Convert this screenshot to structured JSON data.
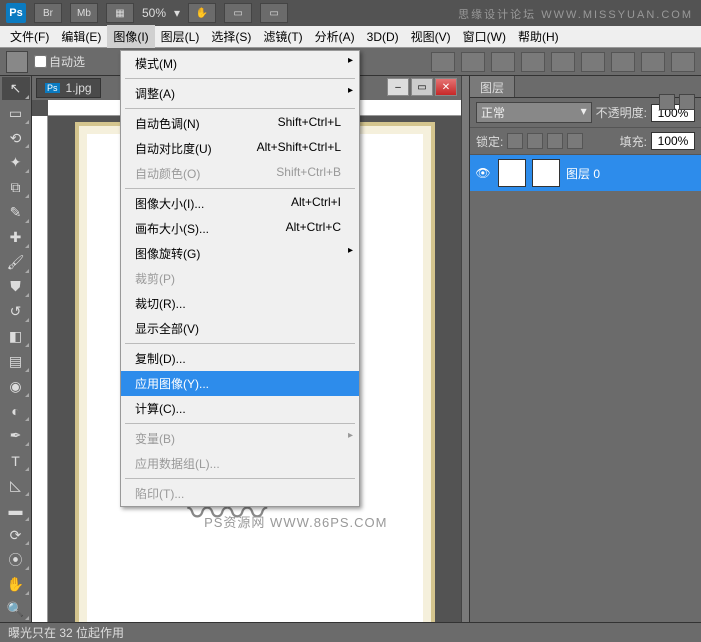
{
  "header": {
    "logo": "Ps",
    "zoom": "50%",
    "watermark": "思缘设计论坛  WWW.MISSYUAN.COM",
    "br": "Br",
    "mb": "Mb"
  },
  "menubar": [
    "文件(F)",
    "编辑(E)",
    "图像(I)",
    "图层(L)",
    "选择(S)",
    "滤镜(T)",
    "分析(A)",
    "3D(D)",
    "视图(V)",
    "窗口(W)",
    "帮助(H)"
  ],
  "options": {
    "auto": "自动选"
  },
  "doc": {
    "tab": "1.jpg"
  },
  "dropdown": [
    {
      "label": "模式(M)",
      "sub": true
    },
    {
      "sep": true
    },
    {
      "label": "调整(A)",
      "sub": true
    },
    {
      "sep": true
    },
    {
      "label": "自动色调(N)",
      "shortcut": "Shift+Ctrl+L"
    },
    {
      "label": "自动对比度(U)",
      "shortcut": "Alt+Shift+Ctrl+L"
    },
    {
      "label": "自动颜色(O)",
      "shortcut": "Shift+Ctrl+B",
      "disabled": true
    },
    {
      "sep": true
    },
    {
      "label": "图像大小(I)...",
      "shortcut": "Alt+Ctrl+I"
    },
    {
      "label": "画布大小(S)...",
      "shortcut": "Alt+Ctrl+C"
    },
    {
      "label": "图像旋转(G)",
      "sub": true
    },
    {
      "label": "裁剪(P)",
      "disabled": true
    },
    {
      "label": "裁切(R)..."
    },
    {
      "label": "显示全部(V)"
    },
    {
      "sep": true
    },
    {
      "label": "复制(D)..."
    },
    {
      "label": "应用图像(Y)...",
      "highlight": true
    },
    {
      "label": "计算(C)..."
    },
    {
      "sep": true
    },
    {
      "label": "变量(B)",
      "sub": true,
      "disabled": true
    },
    {
      "label": "应用数据组(L)...",
      "disabled": true
    },
    {
      "sep": true
    },
    {
      "label": "陷印(T)...",
      "disabled": true
    }
  ],
  "panels": {
    "tab": "图层",
    "blend": "正常",
    "opacity_label": "不透明度:",
    "opacity": "100%",
    "lock_label": "锁定:",
    "fill_label": "填充:",
    "fill": "100%",
    "layer_name": "图层 0"
  },
  "footer": {
    "status": "曝光只在 32 位起作用"
  },
  "canvas": {
    "wm": "PS资源网  WWW.86PS.COM"
  }
}
